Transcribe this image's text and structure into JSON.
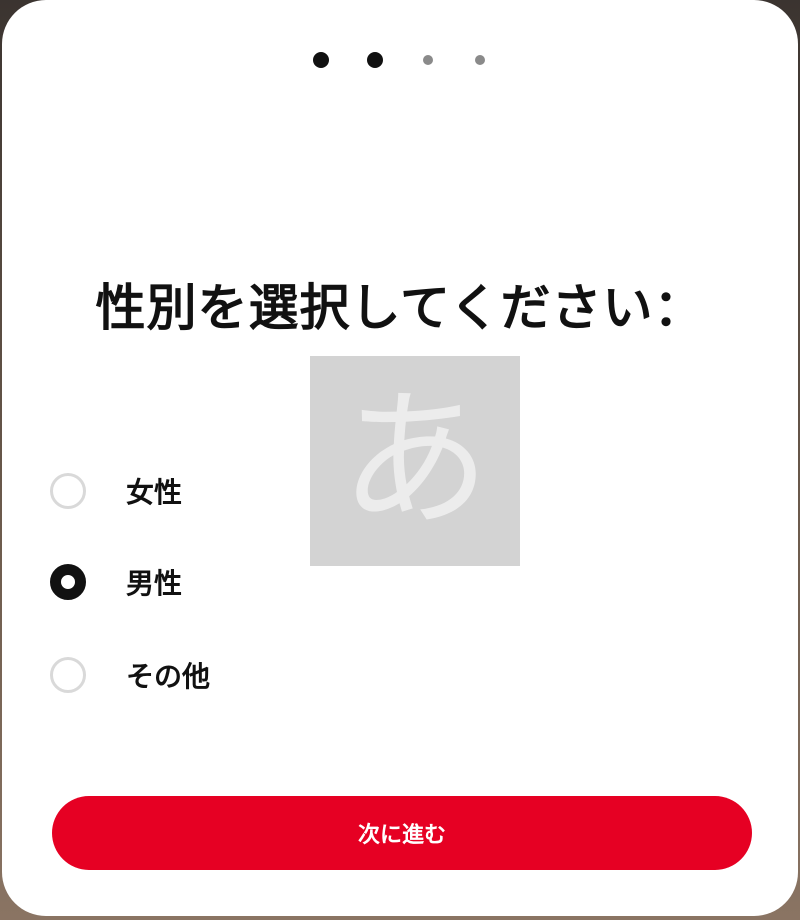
{
  "stepper": {
    "total_steps": 4,
    "completed_steps": 2
  },
  "title": "性別を選択してください：",
  "placeholder_glyph": "あ",
  "options": [
    {
      "label": "女性",
      "selected": false
    },
    {
      "label": "男性",
      "selected": true
    },
    {
      "label": "その他",
      "selected": false
    }
  ],
  "next_button": {
    "label": "次に進む"
  },
  "colors": {
    "accent": "#e60023",
    "text": "#111111",
    "radio_border": "#d9d9d9",
    "placeholder_bg": "#d3d3d3"
  }
}
